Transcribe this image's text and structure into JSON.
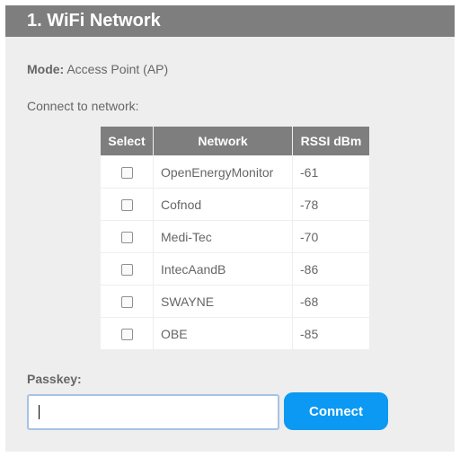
{
  "section": {
    "title": "1. WiFi Network"
  },
  "mode": {
    "label": "Mode:",
    "value": "Access Point (AP)"
  },
  "connect_prompt": "Connect to network:",
  "table": {
    "headers": [
      "Select",
      "Network",
      "RSSI dBm"
    ],
    "rows": [
      {
        "selected": false,
        "network": "OpenEnergyMonitor",
        "rssi": "-61"
      },
      {
        "selected": false,
        "network": "Cofnod",
        "rssi": "-78"
      },
      {
        "selected": false,
        "network": "Medi-Tec",
        "rssi": "-70"
      },
      {
        "selected": false,
        "network": "IntecAandB",
        "rssi": "-86"
      },
      {
        "selected": false,
        "network": "SWAYNE",
        "rssi": "-68"
      },
      {
        "selected": false,
        "network": "OBE",
        "rssi": "-85"
      }
    ]
  },
  "passkey": {
    "label": "Passkey:",
    "value": ""
  },
  "connect_button": "Connect",
  "colors": {
    "header_bg": "#7e7e7e",
    "panel_bg": "#eeeeee",
    "button_bg": "#0b99f3",
    "input_focus_border": "#a7c2e6"
  }
}
